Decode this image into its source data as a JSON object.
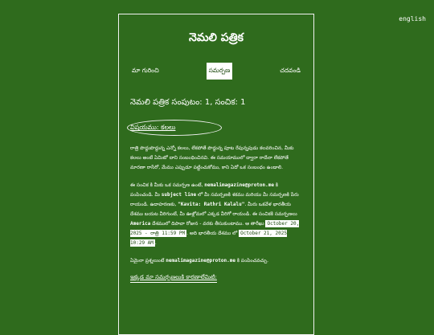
{
  "lang_link": "english",
  "magazine": {
    "title": "నెమలి పత్రిక"
  },
  "nav": {
    "about": "మా గురించి",
    "submission": "సమర్పణ",
    "read": "చదవండి"
  },
  "issue_line": "నెమలి పత్రిక సంపుటం: 1, సంచిక: 1",
  "topic": "విషయము: కలలు",
  "para1": "రాత్రి పొద్దుపొద్దున్న ఎన్నో కలలు, లేకపోతే పొద్దున్న పూట రేపున్నపుడు కలవరించిన, మీకు కలలు అంటే ఏమిటో దాని సంబంధించినవి. ఈ సమయాములో ద్వారా రాదేనా లేకపోతే మారణా రాసేరో, మేము ఎప్పుడూ పట్టించుకోము, కాని ఏదో ఒక సంబంధం ఉండాలి.",
  "para2": {
    "a": "ఈ సంచిక కి మీకు ఒక సమర్పణ ఉంటే,",
    "email": "nemalimagazine@proton.me",
    "b": "కి పంపించండి. మీ",
    "subject": "subject line",
    "c": "లో మీ సమర్పణకి శకము మరియు మీ సమర్పణకి పేరు రాయండి. ఉదాహరణకు,",
    "example": "\"Kavita: Rathri Kalalu\"",
    "d": ". మీరు ఒకవేళ భారతీయ దేశము బయట వీరిగుంటే, మీ ఊళ్లోమలో ఎక్కడ వీరిగో రాయండి. ఈ సంచికకి సమర్పణలు",
    "america": "America",
    "e": "దేశములో దిపావా రోజున - వరకు తీసుకుంటాము. ఆ తారీఖు",
    "date1": "October 20, 2025 - రాత్రి 11:59 PM",
    "f": ". అది భారతీయ దేశము లో",
    "date2": "October 21, 2025 10:29 AM",
    "g": "."
  },
  "para3": {
    "a": "ఏమైనా ప్రశ్నలుంటే",
    "email": "nemalimagazine@proton.me",
    "b": "కి పంపించవచ్చు."
  },
  "footer_link": "ఇక్కడ మా సమర్పణలుకి కారణాలేమిటి:"
}
